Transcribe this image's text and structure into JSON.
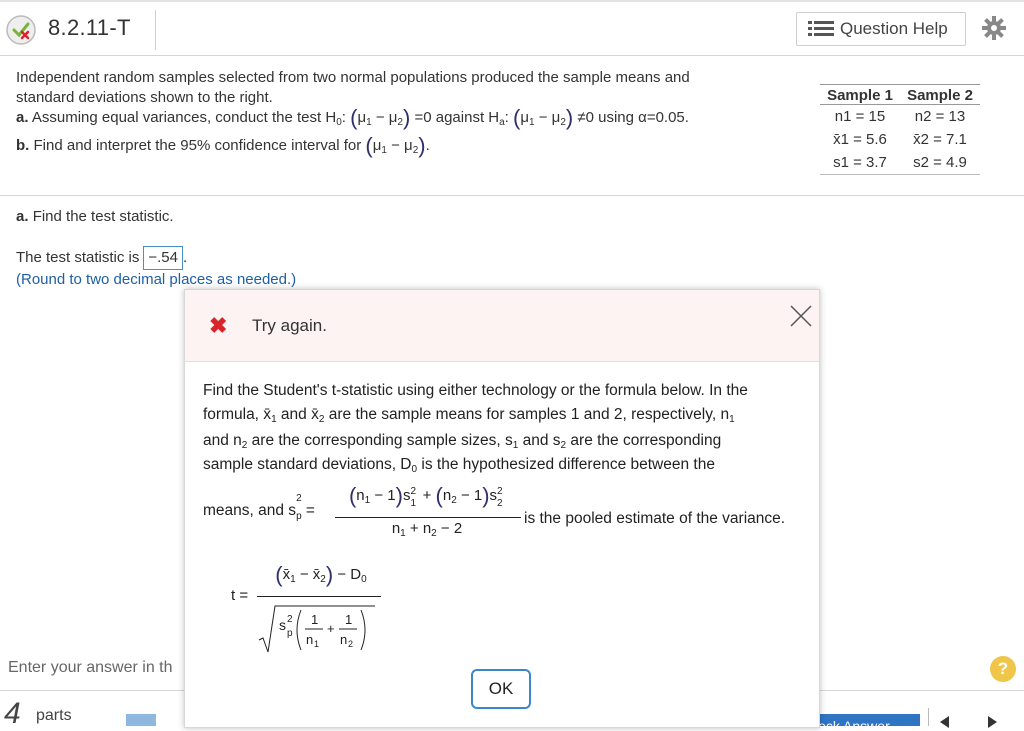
{
  "header": {
    "problem_id": "8.2.11-T",
    "question_help": "Question Help",
    "icons": {
      "status": "partial-correct-icon",
      "help": "list-icon",
      "settings": "gear-icon"
    }
  },
  "problem": {
    "intro_1": "Independent random samples selected from two normal populations produced the sample means and",
    "intro_2": "standard deviations shown to the right.",
    "a_label": "a.",
    "a_text_1": "Assuming equal variances, conduct the test H",
    "a_text_2": "=0 against H",
    "a_text_3": "≠0 using α=0.05.",
    "b_label": "b.",
    "b_text": "Find and interpret the 95% confidence interval for"
  },
  "sample_table": {
    "headers": [
      "Sample 1",
      "Sample 2"
    ],
    "rows": [
      [
        "n1 = 15",
        "n2 = 13"
      ],
      [
        "x̄1 = 5.6",
        "x̄2 = 7.1"
      ],
      [
        "s1 = 3.7",
        "s2 = 4.9"
      ]
    ]
  },
  "part_a": {
    "heading_label": "a.",
    "heading_text": "Find the test statistic.",
    "prompt": "The test statistic is",
    "answer": "−.54",
    "hint": "(Round to two decimal places as needed.)"
  },
  "modal": {
    "title": "Try again.",
    "ok_label": "OK",
    "line1": "Find the Student's t-statistic using either technology or the formula below. In the",
    "line2": "are the sample means for samples 1 and 2, respectively, n",
    "line3": "are the corresponding sample sizes, s",
    "line3b": "are the corresponding",
    "line4": "sample standard deviations, D",
    "line4b": "is the hypothesized difference between the",
    "line5a": "means, and s",
    "line5b": "is the pooled estimate of the variance."
  },
  "footer": {
    "enter_answer": "Enter your answer in th",
    "parts_num": "4",
    "parts_label": "parts",
    "check_answer": "Check Answer",
    "help_glyph": "?"
  },
  "colors": {
    "accent_blue": "#1f5fa6",
    "error_red": "#d9242b",
    "help_yellow": "#f0c64a"
  }
}
